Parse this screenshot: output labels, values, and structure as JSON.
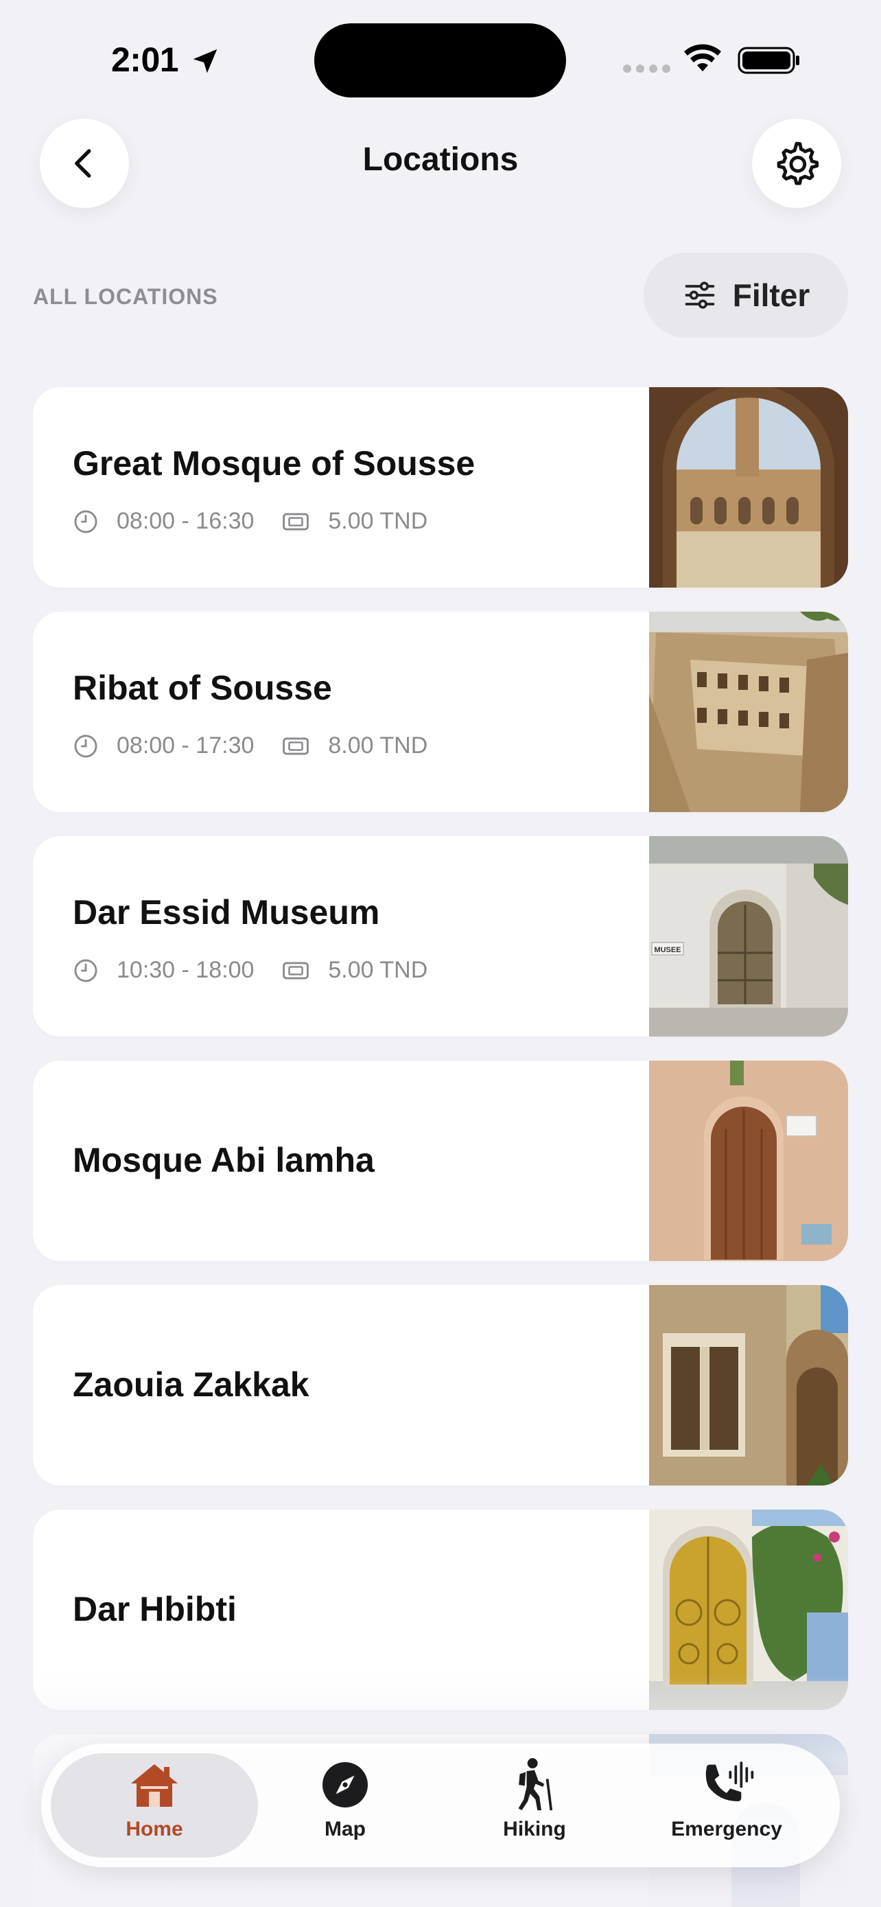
{
  "status_bar": {
    "time": "2:01"
  },
  "header": {
    "title": "Locations"
  },
  "section": {
    "label": "ALL LOCATIONS",
    "filter_label": "Filter"
  },
  "locations": [
    {
      "name": "Great Mosque of Sousse",
      "hours": "08:00 - 16:30",
      "price": "5.00 TND"
    },
    {
      "name": "Ribat of Sousse",
      "hours": "08:00 - 17:30",
      "price": "8.00 TND"
    },
    {
      "name": "Dar Essid Museum",
      "hours": "10:30 - 18:00",
      "price": "5.00 TND"
    },
    {
      "name": "Mosque Abi lamha"
    },
    {
      "name": "Zaouia Zakkak"
    },
    {
      "name": "Dar Hbibti"
    }
  ],
  "photo_signs": {
    "museum": "MUSEE"
  },
  "tabs": [
    {
      "label": "Home",
      "icon": "house-icon",
      "active": true
    },
    {
      "label": "Map",
      "icon": "compass-icon",
      "active": false
    },
    {
      "label": "Hiking",
      "icon": "hiker-icon",
      "active": false
    },
    {
      "label": "Emergency",
      "icon": "phone-icon",
      "active": false
    }
  ],
  "colors": {
    "accent": "#b24a26",
    "background": "#f2f1f6",
    "card": "#ffffff",
    "muted_text": "#8a8a8e"
  }
}
